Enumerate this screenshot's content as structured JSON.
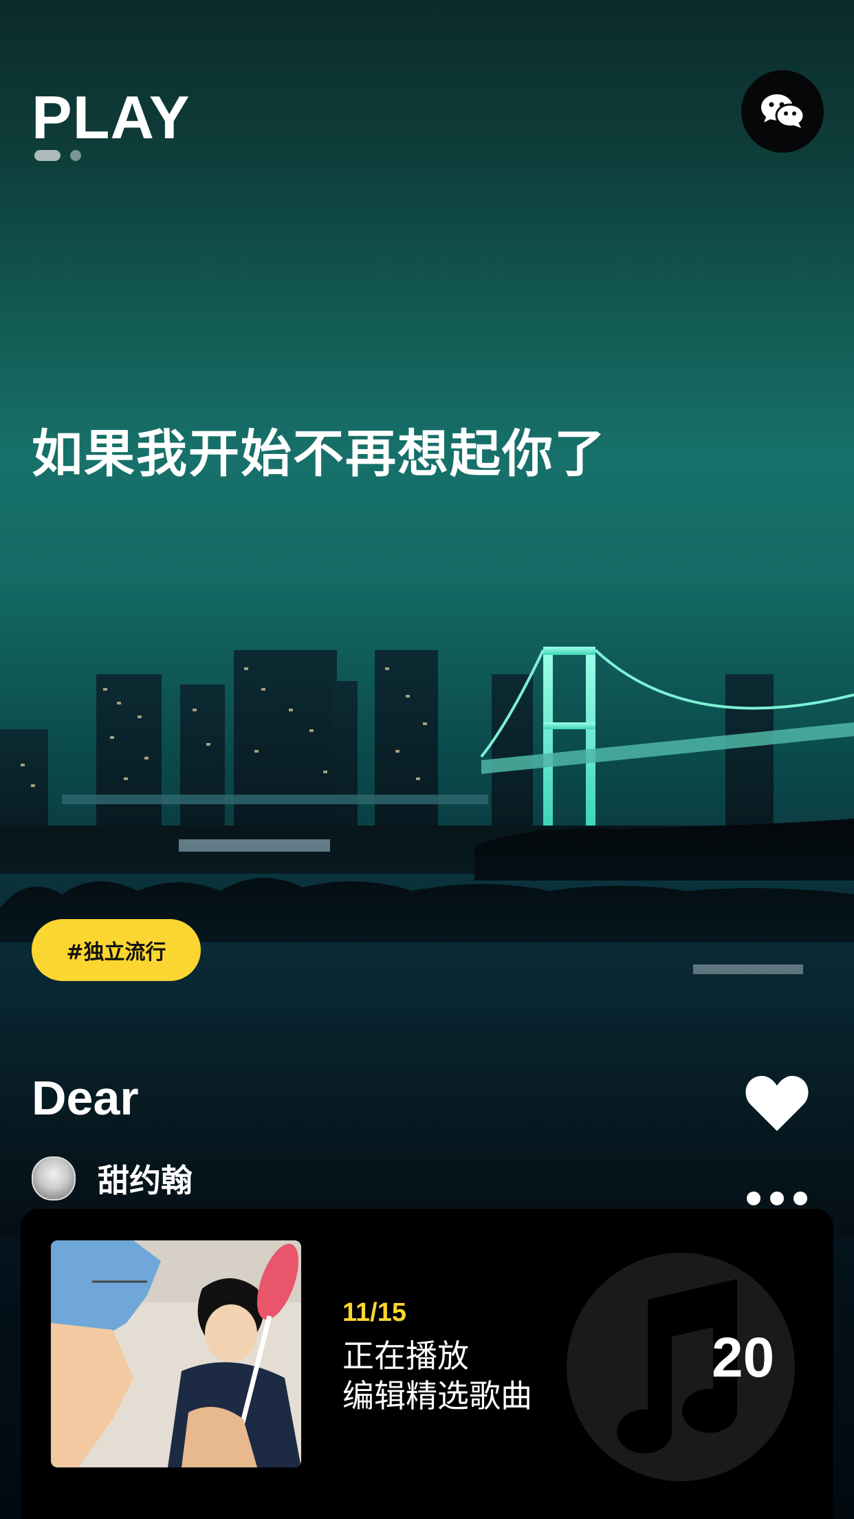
{
  "app": {
    "brand": "PLAY"
  },
  "pager": {
    "pages": 2,
    "active_index": 0
  },
  "header": {
    "share_icon": "wechat-icon"
  },
  "main": {
    "headline": "如果我开始不再想起你了",
    "tag": "#独立流行",
    "song_title": "Dear",
    "artist_name": "甜约翰",
    "like_icon": "heart-icon",
    "more_icon": "more-dots-icon"
  },
  "player": {
    "counter": "11/15",
    "status_line": "正在播放",
    "playlist_name": "编辑精选歌曲",
    "big_number": "20",
    "disc_icon": "music-note-icon"
  },
  "colors": {
    "accent": "#fbd630",
    "player_bg": "#000000",
    "teal_sky": "#17716a"
  }
}
